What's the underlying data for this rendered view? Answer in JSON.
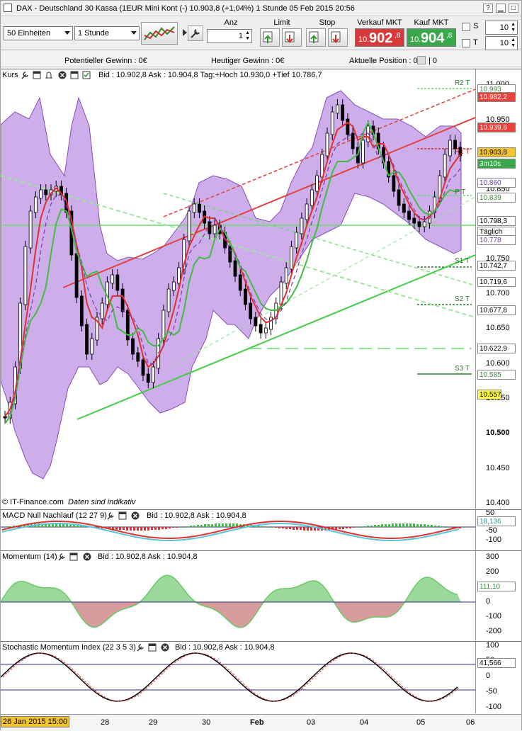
{
  "window": {
    "title": "DAX - Deutschland 30 Kassa (1EUR Mini Kont (-)    10.903,8 (+1,04%)    1 Stunde  05 Feb 2015 20:56",
    "help_label": "?",
    "min_label": "▁",
    "max_label": "□",
    "close_label": "✕"
  },
  "toolbar": {
    "units_select": "50 Einheiten",
    "period_select": "1 Stunde",
    "anz_label": "Anz",
    "anz_value": "1",
    "limit_label": "Limit",
    "stop_label": "Stop",
    "sell_label": "Verkauf MKT",
    "sell_prefix": "10.",
    "sell_big": "902",
    "sell_suffix": ",8",
    "buy_label": "Kauf MKT",
    "buy_prefix": "10.",
    "buy_big": "904",
    "buy_suffix": ",8",
    "s_label": "S",
    "s_value": "10",
    "t_label": "T",
    "t_value": "10",
    "sell_color": "#d63a3a",
    "buy_color": "#39a84a"
  },
  "infobar": {
    "potential": "Potentieller Gewinn : 0€",
    "today": "Heutiger Gewinn : 0€",
    "position_label": "Aktuelle Position : 0",
    "position_after": "| 0"
  },
  "main_panel": {
    "label": "Kurs",
    "info": "Bid : 10.902,8 Ask : 10.904,8 Tag:+Hoch 10.930,0 +Tief 10.786,7",
    "copyright": "© IT-Finance.com",
    "disclaimer": "Daten sind indikativ",
    "pivot_labels": [
      "R2 T",
      "R1 T",
      "P T",
      "S1 T",
      "S2 T",
      "S3 T"
    ],
    "ticks": [
      "11.000",
      "10.950",
      "10.900",
      "10.850",
      "10.800",
      "10.750",
      "10.700",
      "10.650",
      "10.600",
      "10.550",
      "10.500",
      "10.450",
      "10.400"
    ],
    "price_labels": [
      {
        "text": "10.993",
        "bg": "#ffffff",
        "fg": "#3a8a3a"
      },
      {
        "text": "10.982,2",
        "bg": "#e8423a",
        "fg": "#ffffff"
      },
      {
        "text": "10.939,6",
        "bg": "#e8423a",
        "fg": "#ffffff"
      },
      {
        "text": "10.903,8",
        "bg": "#f4c430",
        "fg": "#000000"
      },
      {
        "text": "3m10s",
        "bg": "#3aa84a",
        "fg": "#ffffff"
      },
      {
        "text": "10.860",
        "bg": "#ffffff",
        "fg": "#6a3aa8"
      },
      {
        "text": "10.839",
        "bg": "#ffffff",
        "fg": "#3a8a3a"
      },
      {
        "text": "10.798,3",
        "bg": "#ffffff",
        "fg": "#000000"
      },
      {
        "text": "Täglich",
        "bg": "#ffffff",
        "fg": "#000000"
      },
      {
        "text": "10.778",
        "bg": "#ffffff",
        "fg": "#6a3aa8"
      },
      {
        "text": "10.742,7",
        "bg": "#ffffff",
        "fg": "#000000"
      },
      {
        "text": "10.719,6",
        "bg": "#ffffff",
        "fg": "#000000"
      },
      {
        "text": "10.677,8",
        "bg": "#ffffff",
        "fg": "#000000"
      },
      {
        "text": "10.622,9",
        "bg": "#ffffff",
        "fg": "#000000"
      },
      {
        "text": "10.585",
        "bg": "#ffffff",
        "fg": "#3a8a3a"
      },
      {
        "text": "10.557",
        "bg": "#ffff40",
        "fg": "#000000"
      }
    ]
  },
  "macd_panel": {
    "label": "MACD Null Nachlauf (12 27 9)",
    "info": "Bid : 10.902,8 Ask : 10.904,8",
    "ticks": [
      "50",
      "0",
      "-50",
      "-100"
    ],
    "value_label": "18,136"
  },
  "momentum_panel": {
    "label": "Momentum (14)",
    "info": "Bid : 10.902,8 Ask : 10.904,8",
    "ticks": [
      "300",
      "200",
      "100",
      "0",
      "-100",
      "-200"
    ],
    "value_label": "111,10"
  },
  "stoch_panel": {
    "label": "Stochastic Momentum Index (22 3 5 3)",
    "info": "Bid : 10.902,8 Ask : 10.904,8",
    "ticks": [
      "100",
      "50",
      "0",
      "-50",
      "-100"
    ],
    "value_label": "41,566"
  },
  "xaxis": {
    "current": "26 Jan 2015 15:00",
    "labels": [
      "28",
      "29",
      "30",
      "Feb",
      "03",
      "04",
      "05",
      "06"
    ]
  }
}
